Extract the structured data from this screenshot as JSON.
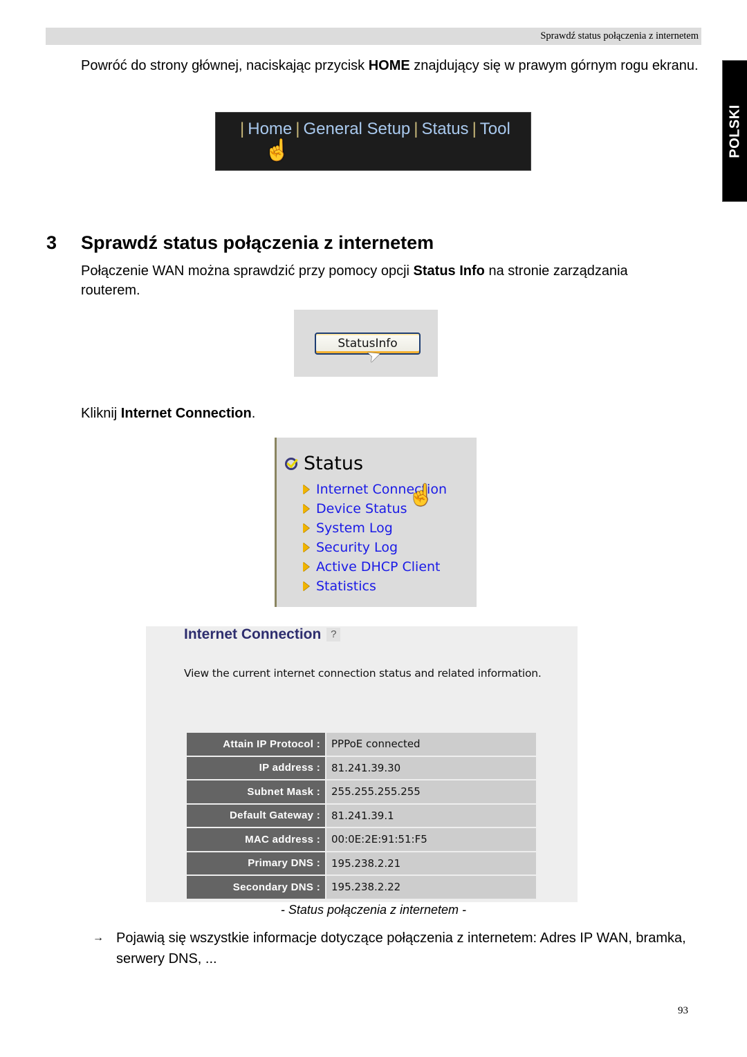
{
  "header": {
    "running_title": "Sprawdź status połączenia z internetem"
  },
  "side_tab": {
    "label": "POLSKI"
  },
  "intro": {
    "text_before": "Powróć do strony głównej, naciskając przycisk ",
    "bold": "HOME",
    "text_after": " znajdujący się w prawym górnym rogu ekranu."
  },
  "nav_screenshot": {
    "items": [
      "Home",
      "General Setup",
      "Status",
      "Tool"
    ],
    "separator": "|",
    "cursor_icon": "hand-pointer-icon"
  },
  "section": {
    "number": "3",
    "title": "Sprawdź status połączenia z internetem",
    "text_before": "Połączenie WAN można sprawdzić przy pomocy opcji ",
    "bold": "Status Info",
    "text_after": " na stronie zarządzania routerem."
  },
  "statusinfo_screenshot": {
    "button_label": "StatusInfo",
    "cursor_icon": "arrow-cursor-icon"
  },
  "click_instruction": {
    "text_before": "Kliknij ",
    "bold": "Internet Connection",
    "text_after": "."
  },
  "status_menu": {
    "title": "Status",
    "title_icon": "check-circle-icon",
    "items": [
      {
        "label": "Internet Connection"
      },
      {
        "label": "Device Status"
      },
      {
        "label": "System Log"
      },
      {
        "label": "Security Log"
      },
      {
        "label": "Active DHCP Client"
      },
      {
        "label": "Statistics"
      }
    ],
    "cursor_icon": "hand-pointer-icon",
    "colors": {
      "link": "#1a1ae6",
      "bullet": "#f0b400"
    }
  },
  "internet_connection": {
    "title": "Internet Connection",
    "help_icon": "?",
    "description": "View the current internet connection status and related information.",
    "rows": [
      {
        "label": "Attain IP Protocol :",
        "value": "PPPoE connected"
      },
      {
        "label": "IP address :",
        "value": "81.241.39.30"
      },
      {
        "label": "Subnet Mask :",
        "value": "255.255.255.255"
      },
      {
        "label": "Default Gateway :",
        "value": "81.241.39.1"
      },
      {
        "label": "MAC address :",
        "value": "00:0E:2E:91:51:F5"
      },
      {
        "label": "Primary DNS :",
        "value": "195.238.2.21"
      },
      {
        "label": "Secondary DNS :",
        "value": "195.238.2.22"
      }
    ]
  },
  "caption": "- Status połączenia z internetem -",
  "result": {
    "arrow": "→",
    "text": "Pojawią się wszystkie informacje dotyczące połączenia z internetem: Adres IP WAN, bramka, serwery DNS, ..."
  },
  "page_number": "93"
}
